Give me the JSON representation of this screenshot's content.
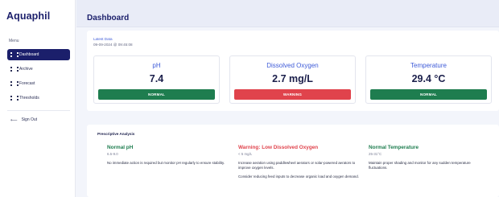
{
  "app": {
    "brand": "Aquaphil"
  },
  "sidebar": {
    "menu_label": "Menu",
    "items": [
      {
        "label": "Dashboard",
        "icon": "grid-icon",
        "active": true
      },
      {
        "label": "Archive",
        "icon": "grid-icon",
        "active": false
      },
      {
        "label": "Forecast",
        "icon": "grid-icon",
        "active": false
      },
      {
        "label": "Thresholds",
        "icon": "grid-icon",
        "active": false
      }
    ],
    "signout": {
      "label": "Sign Out",
      "icon": "sign-out-arrow-icon"
    }
  },
  "header": {
    "title": "Dashboard"
  },
  "latest": {
    "label": "Latest Data",
    "timestamp": "09-09-2024 @ 09:45:08"
  },
  "cards": [
    {
      "title": "pH",
      "value": "7.4",
      "status": "NORMAL",
      "status_color": "#1e7d4f"
    },
    {
      "title": "Dissolved Oxygen",
      "value": "2.7 mg/L",
      "status": "WARNING",
      "status_color": "#e0434c"
    },
    {
      "title": "Temperature",
      "value": "29.4 °C",
      "status": "NORMAL",
      "status_color": "#1e7d4f"
    }
  ],
  "analysis": {
    "title": "Prescriptive Analysis",
    "columns": [
      {
        "title": "Normal pH",
        "title_color": "#1e7d4f",
        "range": "6.5-9.0",
        "text1": "No immediate action is required but monitor pH regularly to ensure stability.",
        "text2": ""
      },
      {
        "title": "Warning: Low Dissolved Oxygen",
        "title_color": "#e0434c",
        "range": "< 5 mg/L",
        "text1": "Increase aeration using paddlewheel aerators or solar-powered aerators to improve oxygen levels.",
        "text2": "Consider reducing feed inputs to decrease organic load and oxygen demand."
      },
      {
        "title": "Normal Temperature",
        "title_color": "#1e7d4f",
        "range": "25-31°C",
        "text1": "Maintain proper shading and monitor for any sudden temperature fluctuations.",
        "text2": ""
      }
    ]
  },
  "colors": {
    "brand": "#1b1f6b",
    "accent": "#3e5bd8",
    "normal": "#1e7d4f",
    "warning": "#e0434c"
  }
}
